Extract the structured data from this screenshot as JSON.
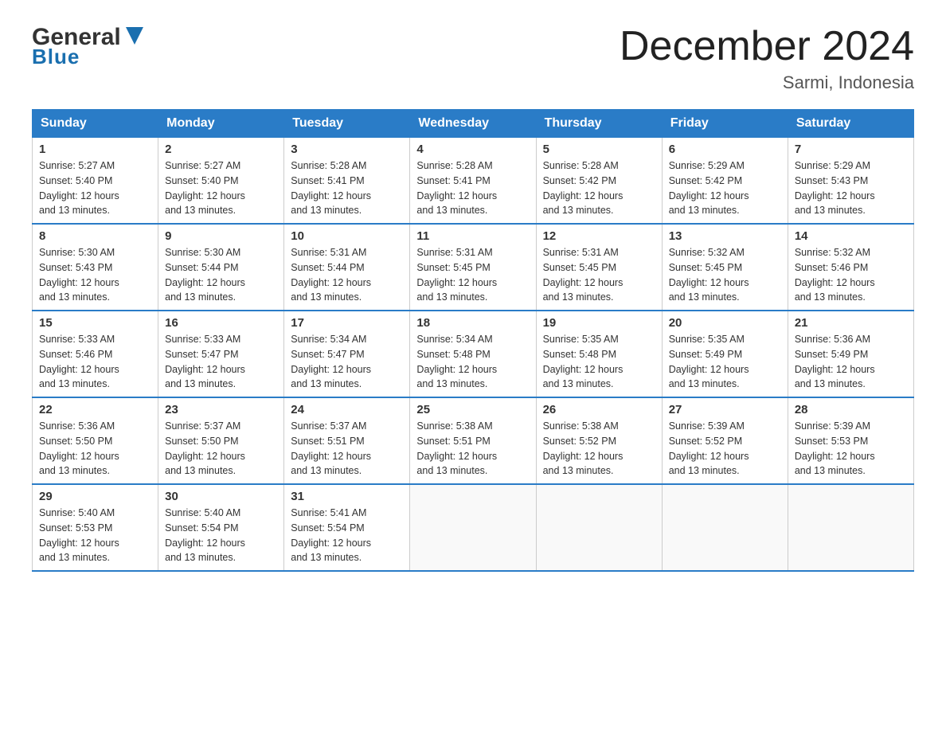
{
  "header": {
    "logo_general": "General",
    "logo_blue": "Blue",
    "title": "December 2024",
    "subtitle": "Sarmi, Indonesia"
  },
  "days_of_week": [
    "Sunday",
    "Monday",
    "Tuesday",
    "Wednesday",
    "Thursday",
    "Friday",
    "Saturday"
  ],
  "weeks": [
    [
      {
        "day": "1",
        "sunrise": "5:27 AM",
        "sunset": "5:40 PM",
        "daylight": "12 hours and 13 minutes."
      },
      {
        "day": "2",
        "sunrise": "5:27 AM",
        "sunset": "5:40 PM",
        "daylight": "12 hours and 13 minutes."
      },
      {
        "day": "3",
        "sunrise": "5:28 AM",
        "sunset": "5:41 PM",
        "daylight": "12 hours and 13 minutes."
      },
      {
        "day": "4",
        "sunrise": "5:28 AM",
        "sunset": "5:41 PM",
        "daylight": "12 hours and 13 minutes."
      },
      {
        "day": "5",
        "sunrise": "5:28 AM",
        "sunset": "5:42 PM",
        "daylight": "12 hours and 13 minutes."
      },
      {
        "day": "6",
        "sunrise": "5:29 AM",
        "sunset": "5:42 PM",
        "daylight": "12 hours and 13 minutes."
      },
      {
        "day": "7",
        "sunrise": "5:29 AM",
        "sunset": "5:43 PM",
        "daylight": "12 hours and 13 minutes."
      }
    ],
    [
      {
        "day": "8",
        "sunrise": "5:30 AM",
        "sunset": "5:43 PM",
        "daylight": "12 hours and 13 minutes."
      },
      {
        "day": "9",
        "sunrise": "5:30 AM",
        "sunset": "5:44 PM",
        "daylight": "12 hours and 13 minutes."
      },
      {
        "day": "10",
        "sunrise": "5:31 AM",
        "sunset": "5:44 PM",
        "daylight": "12 hours and 13 minutes."
      },
      {
        "day": "11",
        "sunrise": "5:31 AM",
        "sunset": "5:45 PM",
        "daylight": "12 hours and 13 minutes."
      },
      {
        "day": "12",
        "sunrise": "5:31 AM",
        "sunset": "5:45 PM",
        "daylight": "12 hours and 13 minutes."
      },
      {
        "day": "13",
        "sunrise": "5:32 AM",
        "sunset": "5:45 PM",
        "daylight": "12 hours and 13 minutes."
      },
      {
        "day": "14",
        "sunrise": "5:32 AM",
        "sunset": "5:46 PM",
        "daylight": "12 hours and 13 minutes."
      }
    ],
    [
      {
        "day": "15",
        "sunrise": "5:33 AM",
        "sunset": "5:46 PM",
        "daylight": "12 hours and 13 minutes."
      },
      {
        "day": "16",
        "sunrise": "5:33 AM",
        "sunset": "5:47 PM",
        "daylight": "12 hours and 13 minutes."
      },
      {
        "day": "17",
        "sunrise": "5:34 AM",
        "sunset": "5:47 PM",
        "daylight": "12 hours and 13 minutes."
      },
      {
        "day": "18",
        "sunrise": "5:34 AM",
        "sunset": "5:48 PM",
        "daylight": "12 hours and 13 minutes."
      },
      {
        "day": "19",
        "sunrise": "5:35 AM",
        "sunset": "5:48 PM",
        "daylight": "12 hours and 13 minutes."
      },
      {
        "day": "20",
        "sunrise": "5:35 AM",
        "sunset": "5:49 PM",
        "daylight": "12 hours and 13 minutes."
      },
      {
        "day": "21",
        "sunrise": "5:36 AM",
        "sunset": "5:49 PM",
        "daylight": "12 hours and 13 minutes."
      }
    ],
    [
      {
        "day": "22",
        "sunrise": "5:36 AM",
        "sunset": "5:50 PM",
        "daylight": "12 hours and 13 minutes."
      },
      {
        "day": "23",
        "sunrise": "5:37 AM",
        "sunset": "5:50 PM",
        "daylight": "12 hours and 13 minutes."
      },
      {
        "day": "24",
        "sunrise": "5:37 AM",
        "sunset": "5:51 PM",
        "daylight": "12 hours and 13 minutes."
      },
      {
        "day": "25",
        "sunrise": "5:38 AM",
        "sunset": "5:51 PM",
        "daylight": "12 hours and 13 minutes."
      },
      {
        "day": "26",
        "sunrise": "5:38 AM",
        "sunset": "5:52 PM",
        "daylight": "12 hours and 13 minutes."
      },
      {
        "day": "27",
        "sunrise": "5:39 AM",
        "sunset": "5:52 PM",
        "daylight": "12 hours and 13 minutes."
      },
      {
        "day": "28",
        "sunrise": "5:39 AM",
        "sunset": "5:53 PM",
        "daylight": "12 hours and 13 minutes."
      }
    ],
    [
      {
        "day": "29",
        "sunrise": "5:40 AM",
        "sunset": "5:53 PM",
        "daylight": "12 hours and 13 minutes."
      },
      {
        "day": "30",
        "sunrise": "5:40 AM",
        "sunset": "5:54 PM",
        "daylight": "12 hours and 13 minutes."
      },
      {
        "day": "31",
        "sunrise": "5:41 AM",
        "sunset": "5:54 PM",
        "daylight": "12 hours and 13 minutes."
      },
      null,
      null,
      null,
      null
    ]
  ],
  "labels": {
    "sunrise": "Sunrise:",
    "sunset": "Sunset:",
    "daylight": "Daylight:"
  }
}
